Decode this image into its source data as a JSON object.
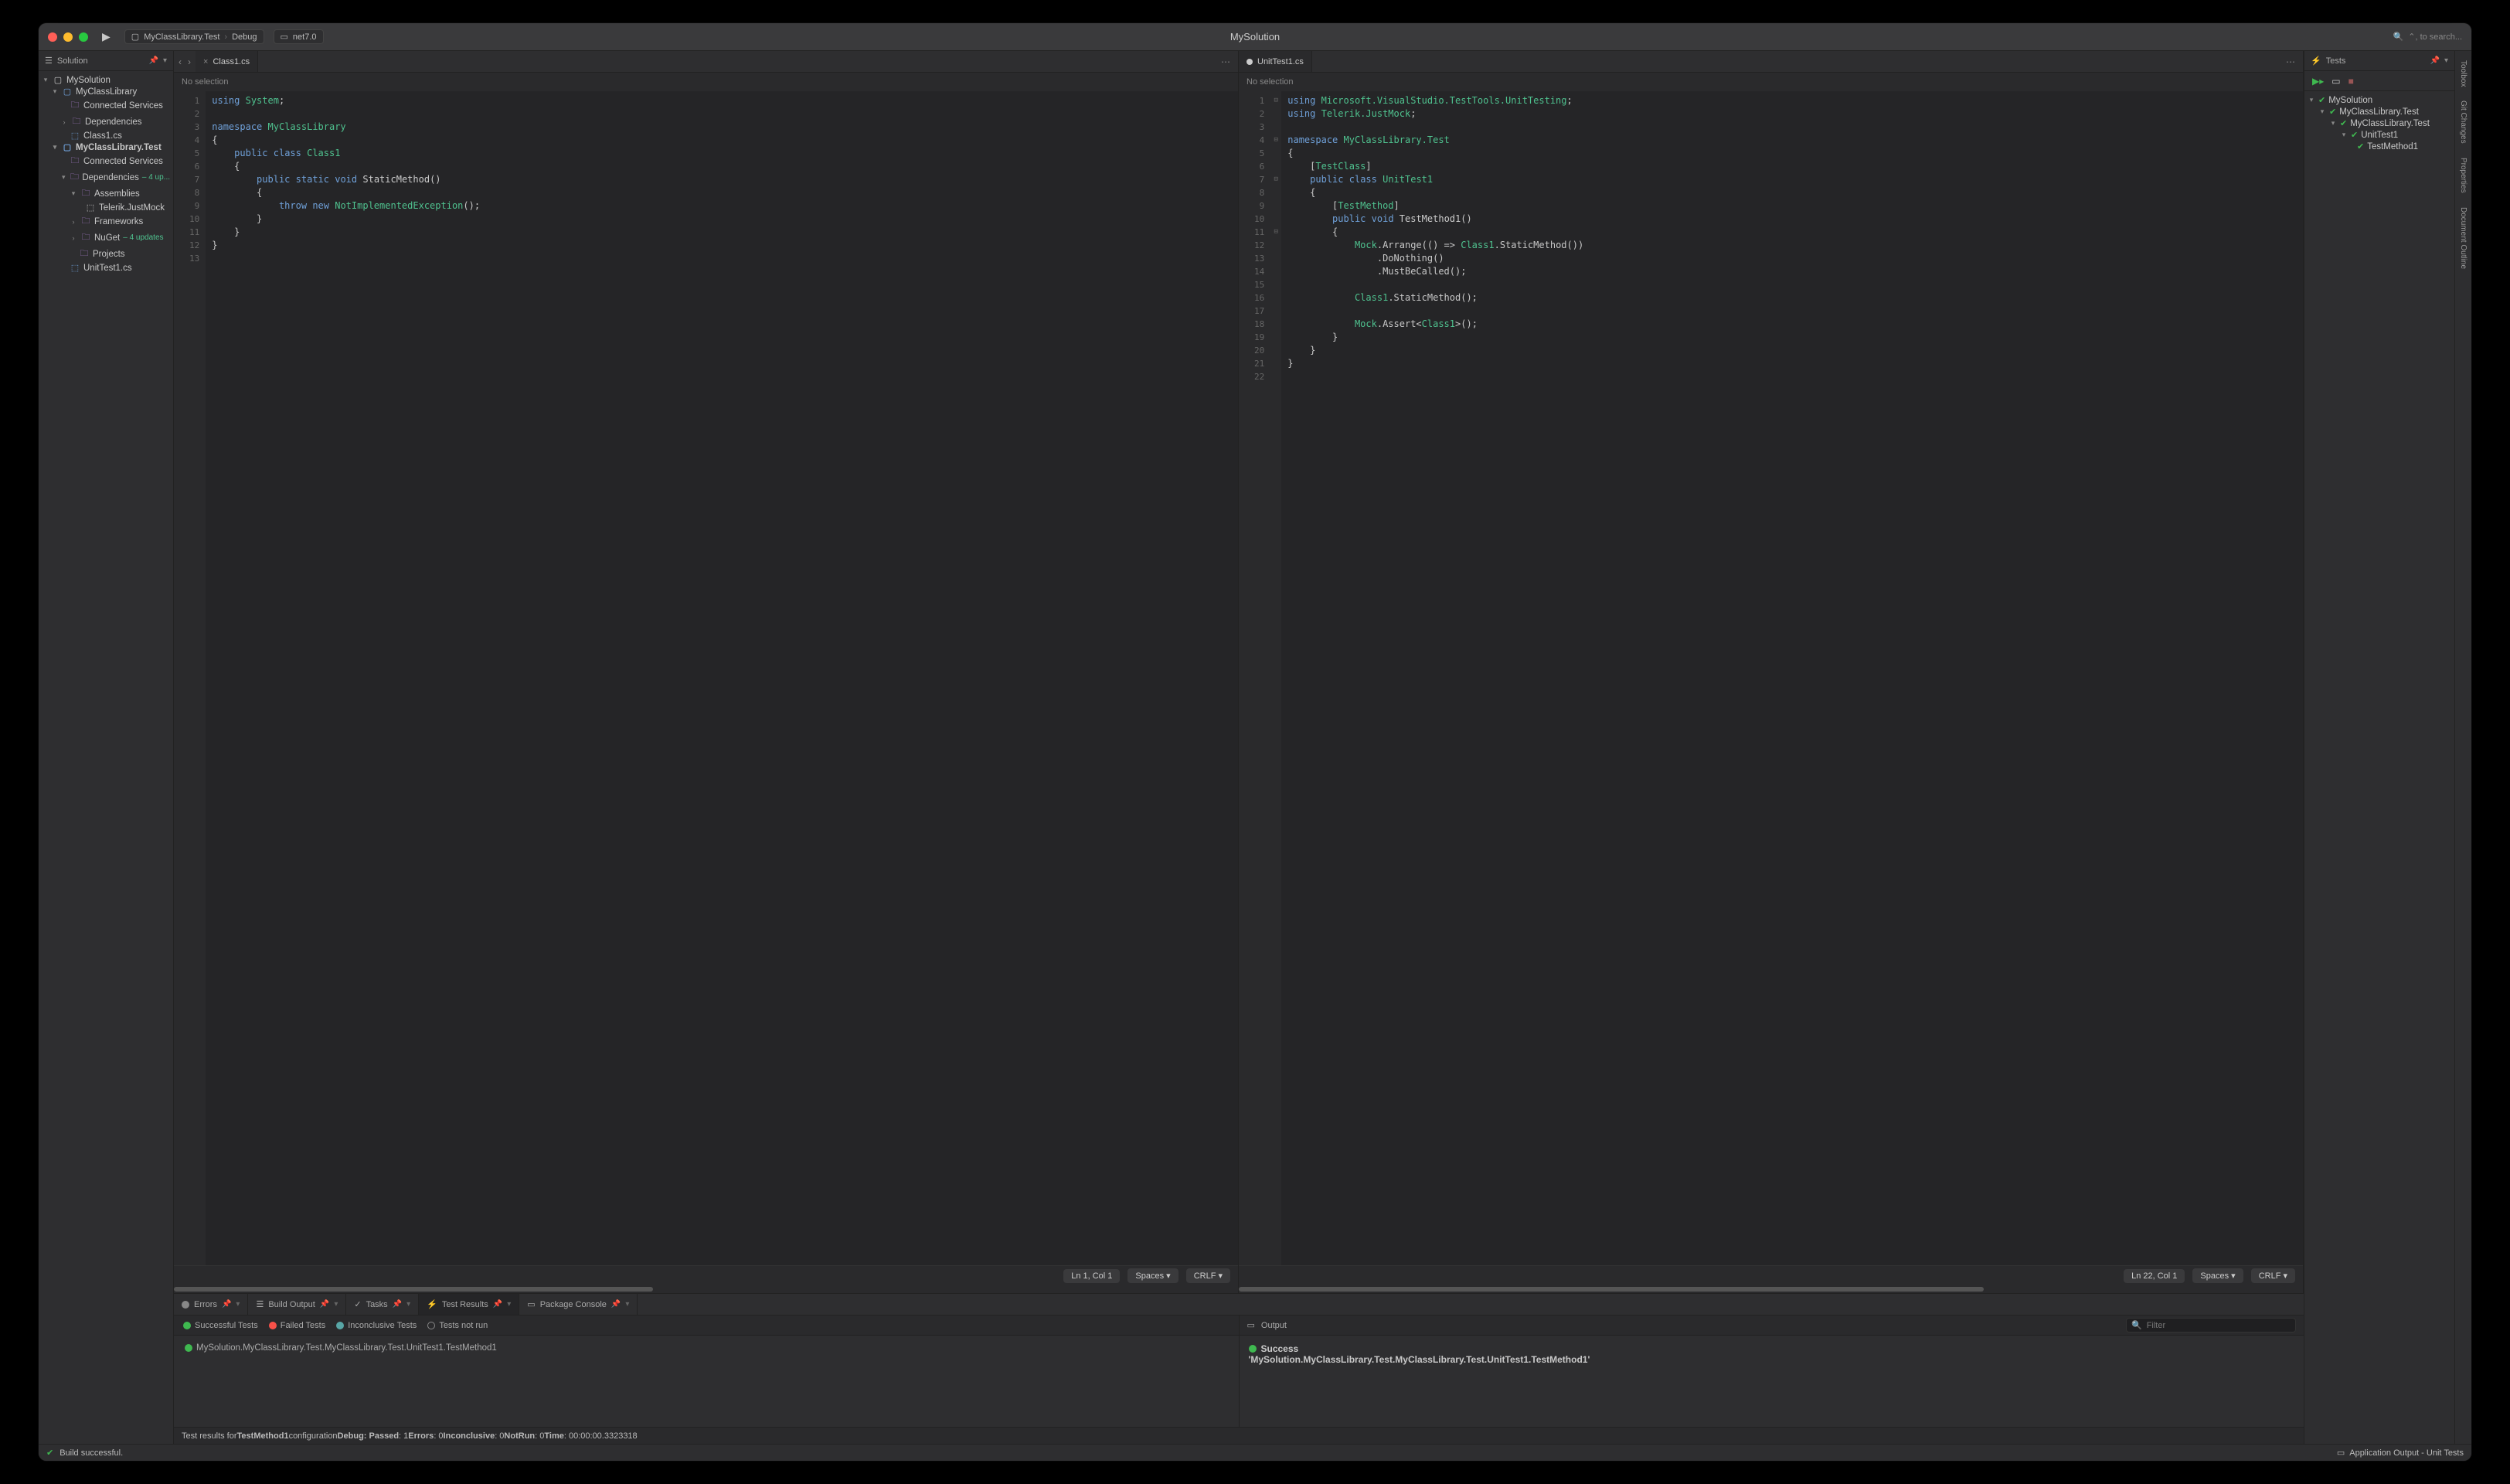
{
  "titlebar": {
    "solution_title": "MySolution",
    "breadcrumb_project": "MyClassLibrary.Test",
    "breadcrumb_config": "Debug",
    "breadcrumb_target": "net7.0",
    "search_placeholder": "⌃, to search..."
  },
  "sidebar_left": {
    "title": "Solution",
    "tree": {
      "root": "MySolution",
      "lib": "MyClassLibrary",
      "lib_connected": "Connected Services",
      "lib_deps": "Dependencies",
      "lib_class": "Class1.cs",
      "test": "MyClassLibrary.Test",
      "test_connected": "Connected Services",
      "test_deps": "Dependencies",
      "test_deps_updates": "– 4 up...",
      "assemblies": "Assemblies",
      "justmock": "Telerik.JustMock",
      "frameworks": "Frameworks",
      "nuget": "NuGet",
      "nuget_updates": "– 4 updates",
      "projects": "Projects",
      "unittest": "UnitTest1.cs"
    }
  },
  "editor1": {
    "tab": "Class1.cs",
    "crumb": "No selection",
    "status_pos": "Ln 1, Col 1",
    "status_spaces": "Spaces",
    "status_eol": "CRLF",
    "lines": 13
  },
  "editor2": {
    "tab": "UnitTest1.cs",
    "crumb": "No selection",
    "status_pos": "Ln 22, Col 1",
    "status_spaces": "Spaces",
    "status_eol": "CRLF",
    "lines": 22
  },
  "bottom": {
    "tabs": {
      "errors": "Errors",
      "build": "Build Output",
      "tasks": "Tasks",
      "tests": "Test Results",
      "package": "Package Console"
    },
    "filters": {
      "success": "Successful Tests",
      "failed": "Failed Tests",
      "inconclusive": "Inconclusive Tests",
      "notrun": "Tests not run"
    },
    "output_tab": "Output",
    "filter_placeholder": "Filter",
    "test_row": "MySolution.MyClassLibrary.Test.MyClassLibrary.Test.UnitTest1.TestMethod1",
    "success_title": "Success",
    "success_detail": "'MySolution.MyClassLibrary.Test.MyClassLibrary.Test.UnitTest1.TestMethod1'",
    "status_prefix": "Test results for ",
    "status_test": "TestMethod1",
    "status_mid": " configuration ",
    "status_config": "Debug",
    "status_passed_l": ": Passed",
    "status_passed_v": ": 1 ",
    "status_errors_l": "Errors",
    "status_errors_v": ": 0 ",
    "status_inc_l": "Inconclusive",
    "status_inc_v": ": 0 ",
    "status_notrun_l": "NotRun",
    "status_notrun_v": ": 0 ",
    "status_time_l": "Time",
    "status_time_v": ": 00:00:00.3323318"
  },
  "sidebar_right": {
    "title": "Tests",
    "tree": {
      "root": "MySolution",
      "project": "MyClassLibrary.Test",
      "ns": "MyClassLibrary.Test",
      "cls": "UnitTest1",
      "method": "TestMethod1"
    }
  },
  "rail": {
    "toolbox": "Toolbox",
    "git": "Git Changes",
    "props": "Properties",
    "outline": "Document Outline"
  },
  "footer": {
    "build": "Build successful.",
    "app_output": "Application Output - Unit Tests"
  }
}
